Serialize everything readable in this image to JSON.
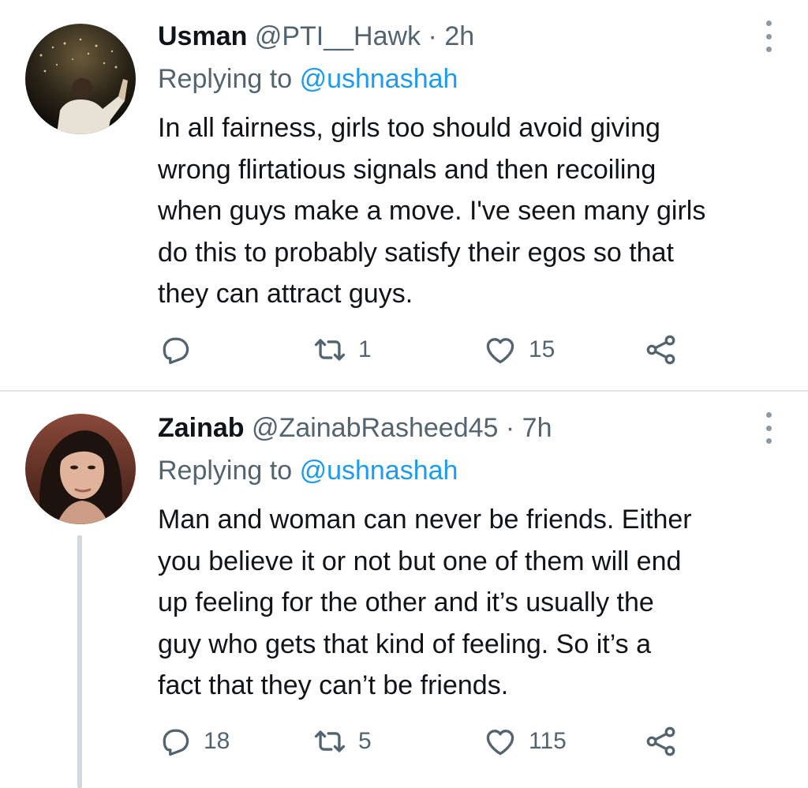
{
  "tweets": [
    {
      "name": "Usman",
      "handle": "@PTI__Hawk",
      "separator": "·",
      "time": "2h",
      "replying_prefix": "Replying to",
      "replying_to": "@ushnashah",
      "text": "In all fairness, girls too should avoid giving\nwrong flirtatious signals and then recoiling\nwhen guys make a move. I've seen many girls\ndo this to probably satisfy their egos so that\nthey can attract guys.",
      "replies": "",
      "retweets": "1",
      "likes": "15"
    },
    {
      "name": "Zainab",
      "handle": "@ZainabRasheed45",
      "separator": "·",
      "time": "7h",
      "replying_prefix": "Replying to",
      "replying_to": "@ushnashah",
      "text": "Man and woman can never be friends. Either\nyou believe it or not but one of them will end\nup feeling for the other and it’s usually the\nguy who gets that kind of feeling. So it’s a\nfact that they can’t be friends.",
      "replies": "18",
      "retweets": "5",
      "likes": "115"
    }
  ],
  "icons": {
    "reply": "reply-icon",
    "retweet": "retweet-icon",
    "like": "heart-icon",
    "share": "share-icon",
    "more": "more-options-icon"
  },
  "colors": {
    "text": "#0f1419",
    "secondary": "#536471",
    "link": "#1d9bf0",
    "divider": "#e3e6e9"
  }
}
